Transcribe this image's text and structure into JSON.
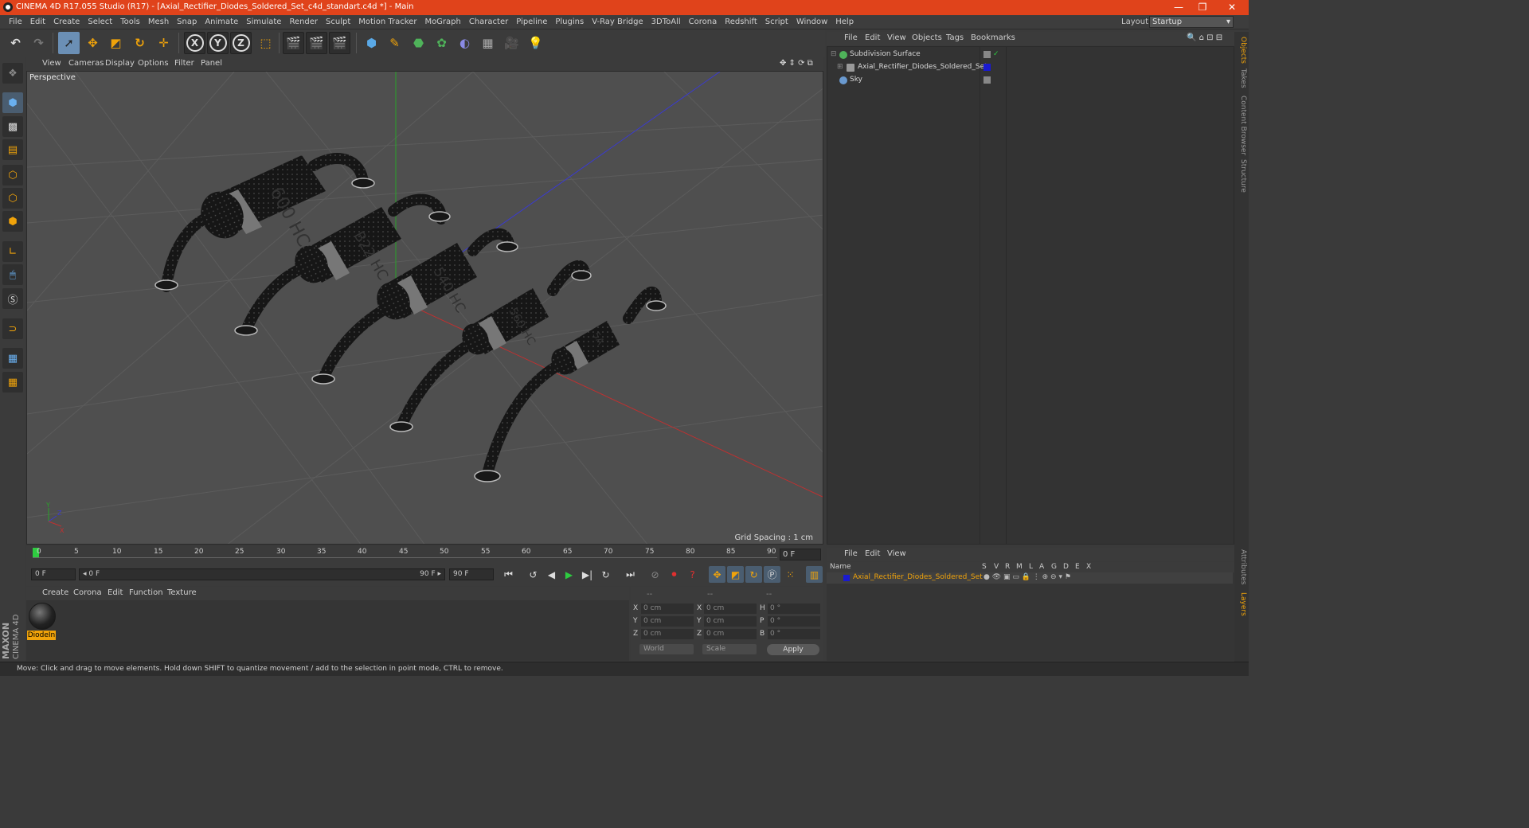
{
  "window": {
    "title": "CINEMA 4D R17.055 Studio (R17) - [Axial_Rectifier_Diodes_Soldered_Set_c4d_standart.c4d *] - Main",
    "minimize": "—",
    "maximize": "❐",
    "close": "✕"
  },
  "menu": {
    "items": [
      "File",
      "Edit",
      "Create",
      "Select",
      "Tools",
      "Mesh",
      "Snap",
      "Animate",
      "Simulate",
      "Render",
      "Sculpt",
      "Motion Tracker",
      "MoGraph",
      "Character",
      "Pipeline",
      "Plugins",
      "V-Ray Bridge",
      "3DToAll",
      "Corona",
      "Redshift",
      "Script",
      "Window",
      "Help"
    ],
    "layout_label": "Layout:",
    "layout_value": "Startup"
  },
  "viewport": {
    "menu": [
      "View",
      "Cameras",
      "Display",
      "Options",
      "Filter",
      "Panel"
    ],
    "label": "Perspective",
    "grid_spacing": "Grid Spacing : 1 cm"
  },
  "timeline": {
    "ticks": [
      "0",
      "5",
      "10",
      "15",
      "20",
      "25",
      "30",
      "35",
      "40",
      "45",
      "50",
      "55",
      "60",
      "65",
      "70",
      "75",
      "80",
      "85",
      "90"
    ],
    "current_frame": "0 F",
    "start_field": "0 F",
    "range_start": "◂ 0 F",
    "range_end": "90 F ▸",
    "end_field": "90 F"
  },
  "material": {
    "menu": [
      "Create",
      "Corona",
      "Edit",
      "Function",
      "Texture"
    ],
    "name": "DiodeIn"
  },
  "coords": {
    "headers": [
      "--",
      "--",
      "--"
    ],
    "rows": [
      {
        "l1": "X",
        "v1": "0 cm",
        "l2": "X",
        "v2": "0 cm",
        "l3": "H",
        "v3": "0 °"
      },
      {
        "l1": "Y",
        "v1": "0 cm",
        "l2": "Y",
        "v2": "0 cm",
        "l3": "P",
        "v3": "0 °"
      },
      {
        "l1": "Z",
        "v1": "0 cm",
        "l2": "Z",
        "v2": "0 cm",
        "l3": "B",
        "v3": "0 °"
      }
    ],
    "mode": "World",
    "transform": "Scale",
    "apply": "Apply"
  },
  "objects": {
    "menu": [
      "File",
      "Edit",
      "View",
      "Objects",
      "Tags",
      "Bookmarks"
    ],
    "items": [
      {
        "name": "Subdivision Surface",
        "icon_color": "#4fb35a"
      },
      {
        "name": "Axial_Rectifier_Diodes_Soldered_Set",
        "icon_color": "#9a9a9a"
      },
      {
        "name": "Sky",
        "icon_color": "#6a9ad0"
      }
    ]
  },
  "layers": {
    "menu": [
      "File",
      "Edit",
      "View"
    ],
    "headers": [
      "Name",
      "S",
      "V",
      "R",
      "M",
      "L",
      "A",
      "G",
      "D",
      "E",
      "X"
    ],
    "row_name": "Axial_Rectifier_Diodes_Soldered_Set",
    "row_color": "#1a1ad0"
  },
  "right_tabs": [
    "Objects",
    "Takes",
    "Content Browser",
    "Structure",
    "Attributes",
    "Layers"
  ],
  "status": "Move: Click and drag to move elements. Hold down SHIFT to quantize movement / add to the selection in point mode, CTRL to remove.",
  "logo": {
    "line1": "MAXON",
    "line2": "CINEMA 4D"
  },
  "diodes": [
    {
      "label": "600 HC"
    },
    {
      "label": "B22 HC"
    },
    {
      "label": "540 HC"
    },
    {
      "label": "560 HC"
    },
    {
      "label": "5A"
    }
  ],
  "colors": {
    "accent": "#e0431b",
    "selection": "#f0a30a"
  }
}
